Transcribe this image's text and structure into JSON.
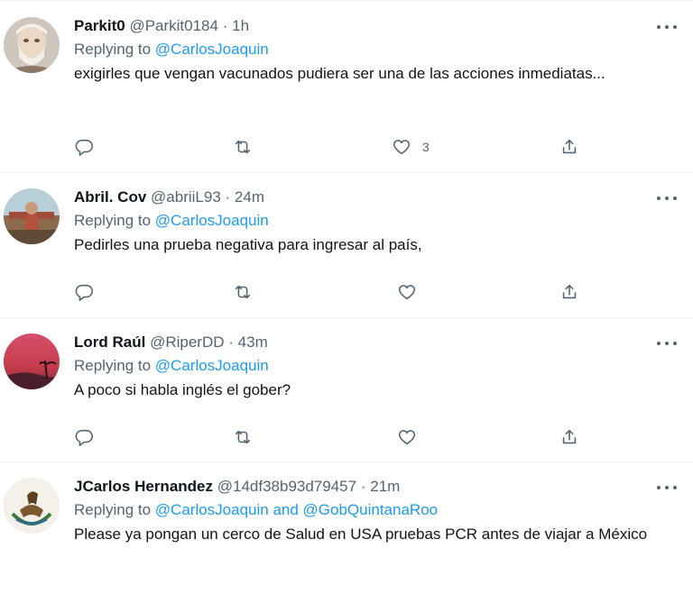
{
  "tweets": [
    {
      "name": "Parkit0",
      "handle": "@Parkit0184",
      "separator": "·",
      "time": "1h",
      "replying_prefix": "Replying to",
      "mentions": "@CarlosJoaquin",
      "text": "exigirles que vengan vacunados pudiera ser una de las acciones inmediatas...",
      "like_count": "3"
    },
    {
      "name": "Abril. Cov",
      "handle": "@abriiL93",
      "separator": "·",
      "time": "24m",
      "replying_prefix": "Replying to",
      "mentions": "@CarlosJoaquin",
      "text": "Pedirles una prueba negativa para ingresar al país,",
      "like_count": ""
    },
    {
      "name": "Lord Raúl",
      "handle": "@RiperDD",
      "separator": "·",
      "time": "43m",
      "replying_prefix": "Replying to",
      "mentions": "@CarlosJoaquin",
      "text": "A poco si habla inglés el gober?",
      "like_count": ""
    },
    {
      "name": "JCarlos Hernandez",
      "handle": "@14df38b93d79457",
      "separator": "·",
      "time": "21m",
      "replying_prefix": "Replying to",
      "mentions": "@CarlosJoaquin and @GobQuintanaRoo",
      "text": "Please ya pongan un cerco de Salud en USA pruebas PCR antes de viajar a México",
      "like_count": ""
    }
  ],
  "icons": {
    "reply": "reply-icon",
    "retweet": "retweet-icon",
    "like": "like-icon",
    "share": "share-icon",
    "more": "more-icon"
  },
  "colors": {
    "link": "#1d9bf0",
    "secondary_text": "#536471",
    "divider": "#eff3f4"
  }
}
